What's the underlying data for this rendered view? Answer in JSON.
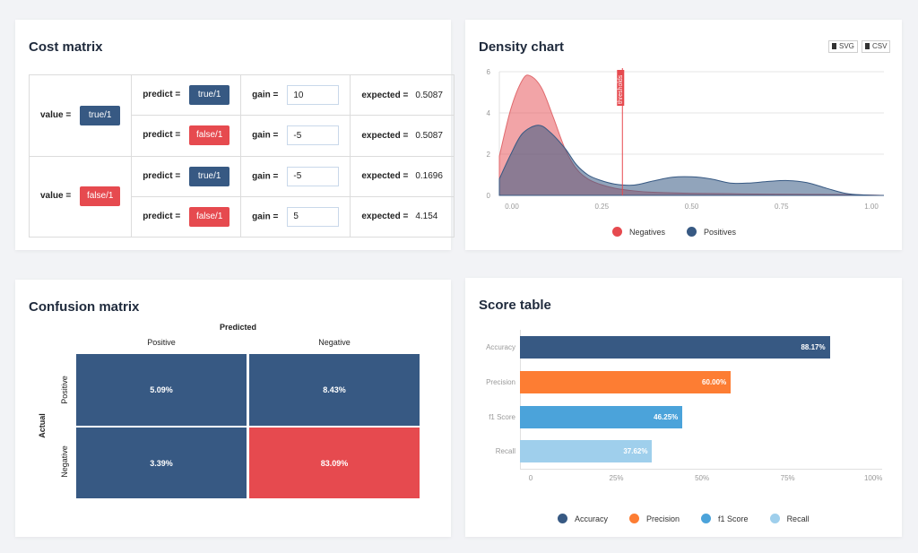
{
  "cost_matrix": {
    "title": "Cost matrix",
    "value_label": "value =",
    "predict_label": "predict =",
    "gain_label": "gain =",
    "expected_label": "expected =",
    "groups": [
      {
        "value": "true/1",
        "rows": [
          {
            "predict": "true/1",
            "gain": "10",
            "expected": "0.5087"
          },
          {
            "predict": "false/1",
            "gain": "-5",
            "expected": "0.5087"
          }
        ]
      },
      {
        "value": "false/1",
        "rows": [
          {
            "predict": "true/1",
            "gain": "-5",
            "expected": "0.1696"
          },
          {
            "predict": "false/1",
            "gain": "5",
            "expected": "4.154"
          }
        ]
      }
    ]
  },
  "density": {
    "title": "Density chart",
    "buttons": [
      "SVG",
      "CSV"
    ],
    "threshold_label": "thresholds"
  },
  "confusion": {
    "title": "Confusion matrix",
    "predicted_label": "Predicted",
    "actual_label": "Actual",
    "col_labels": [
      "Positive",
      "Negative"
    ],
    "row_labels": [
      "Positive",
      "Negative"
    ],
    "cells": [
      [
        "5.09%",
        "8.43%"
      ],
      [
        "3.39%",
        "83.09%"
      ]
    ]
  },
  "score": {
    "title": "Score table"
  },
  "colors": {
    "navy": "#375983",
    "red": "#e64a4f",
    "orange": "#fd7d33",
    "blue": "#4ba3da",
    "lightblue": "#9fcfec"
  },
  "chart_data": [
    {
      "type": "area",
      "title": "Density chart",
      "xlim": [
        0,
        1
      ],
      "ylim": [
        0,
        6
      ],
      "x_ticks": [
        "0.00",
        "0.25",
        "0.50",
        "0.75",
        "1.00"
      ],
      "y_ticks": [
        "0",
        "2",
        "4",
        "6"
      ],
      "threshold": 0.32,
      "legend": [
        "Negatives",
        "Positives"
      ],
      "legend_position": "bottom",
      "series": [
        {
          "name": "Negatives",
          "x": [
            0.0,
            0.03,
            0.06,
            0.08,
            0.11,
            0.14,
            0.17,
            0.2,
            0.23,
            0.26,
            0.3,
            0.35,
            0.4,
            0.5,
            0.6,
            0.7,
            0.8,
            0.9,
            1.0
          ],
          "y": [
            1.9,
            4.2,
            5.6,
            5.8,
            5.2,
            3.8,
            2.3,
            1.3,
            0.8,
            0.55,
            0.35,
            0.22,
            0.15,
            0.1,
            0.08,
            0.06,
            0.05,
            0.04,
            0.0
          ]
        },
        {
          "name": "Positives",
          "x": [
            0.0,
            0.03,
            0.06,
            0.1,
            0.13,
            0.17,
            0.2,
            0.23,
            0.26,
            0.3,
            0.35,
            0.4,
            0.45,
            0.5,
            0.55,
            0.6,
            0.65,
            0.7,
            0.75,
            0.8,
            0.85,
            0.9,
            0.95,
            1.0
          ],
          "y": [
            0.8,
            2.0,
            3.0,
            3.4,
            3.1,
            2.3,
            1.5,
            1.0,
            0.75,
            0.55,
            0.5,
            0.7,
            0.88,
            0.9,
            0.8,
            0.6,
            0.6,
            0.68,
            0.72,
            0.62,
            0.35,
            0.1,
            0.02,
            0.0
          ]
        }
      ]
    },
    {
      "type": "bar",
      "title": "Score table",
      "orientation": "horizontal",
      "categories": [
        "Accuracy",
        "Precision",
        "f1 Score",
        "Recall"
      ],
      "values": [
        88.17,
        60.0,
        46.25,
        37.62
      ],
      "labels": [
        "88.17%",
        "60.00%",
        "46.25%",
        "37.62%"
      ],
      "x_ticks": [
        "0",
        "25%",
        "50%",
        "75%",
        "100%"
      ],
      "xlim": [
        0,
        100
      ],
      "legend": [
        "Accuracy",
        "Precision",
        "f1 Score",
        "Recall"
      ],
      "legend_position": "bottom"
    },
    {
      "type": "heatmap",
      "title": "Confusion matrix",
      "xlabel": "Predicted",
      "ylabel": "Actual",
      "x_categories": [
        "Positive",
        "Negative"
      ],
      "y_categories": [
        "Positive",
        "Negative"
      ],
      "values": [
        [
          5.09,
          8.43
        ],
        [
          3.39,
          83.09
        ]
      ]
    }
  ]
}
